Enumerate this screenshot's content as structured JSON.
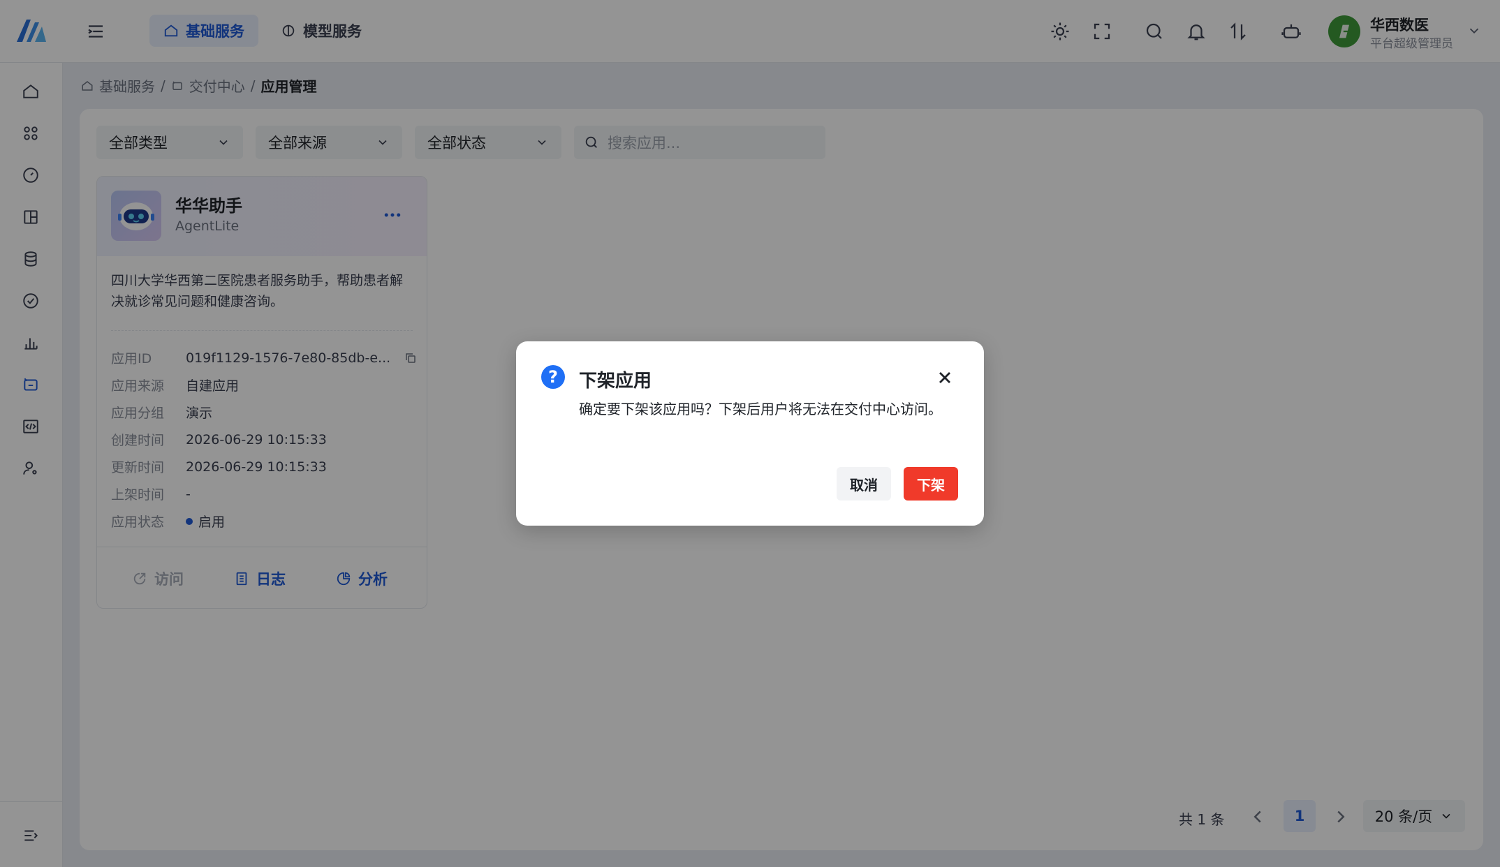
{
  "header": {
    "nav_tabs": [
      {
        "label": "基础服务",
        "icon": "home-icon"
      },
      {
        "label": "模型服务",
        "icon": "model-icon"
      }
    ],
    "user": {
      "name": "华西数医",
      "role": "平台超级管理员"
    }
  },
  "breadcrumb": {
    "items": [
      "基础服务",
      "交付中心",
      "应用管理"
    ],
    "separator": "/"
  },
  "filters": {
    "type": "全部类型",
    "source": "全部来源",
    "status": "全部状态",
    "search_placeholder": "搜索应用..."
  },
  "app_card": {
    "title": "华华助手",
    "subtitle": "AgentLite",
    "description": "四川大学华西第二医院患者服务助手，帮助患者解决就诊常见问题和健康咨询。",
    "meta": [
      {
        "key": "应用ID",
        "value": "019f1129-1576-7e80-85db-e..."
      },
      {
        "key": "应用来源",
        "value": "自建应用"
      },
      {
        "key": "应用分组",
        "value": "演示"
      },
      {
        "key": "创建时间",
        "value": "2026-06-29 10:15:33"
      },
      {
        "key": "更新时间",
        "value": "2026-06-29 10:15:33"
      },
      {
        "key": "上架时间",
        "value": "-"
      },
      {
        "key": "应用状态",
        "value": "启用"
      }
    ],
    "actions": {
      "visit": "访问",
      "logs": "日志",
      "analyze": "分析"
    }
  },
  "pagination": {
    "total": "共 1 条",
    "current": "1",
    "page_size": "20 条/页"
  },
  "modal": {
    "title": "下架应用",
    "text": "确定要下架该应用吗？下架后用户将无法在交付中心访问。",
    "cancel": "取消",
    "confirm": "下架"
  },
  "colors": {
    "primary": "#1f5ad6",
    "danger": "#f03a2a",
    "avatar": "#3e9a3a"
  }
}
